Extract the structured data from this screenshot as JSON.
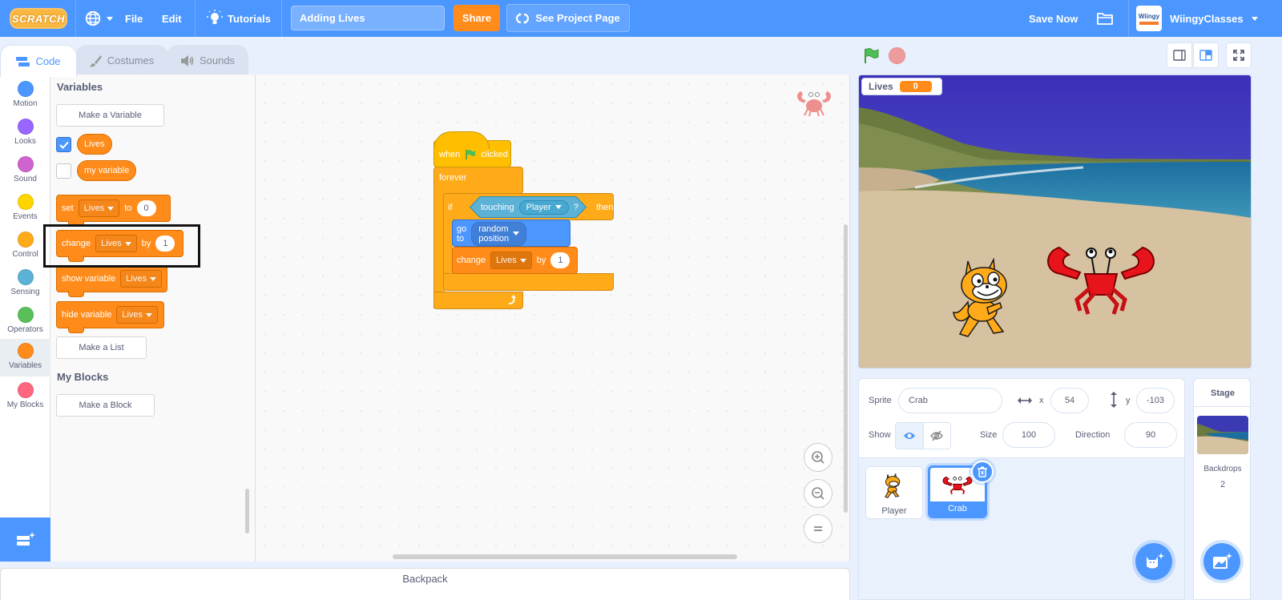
{
  "menubar": {
    "logo": "SCRATCH",
    "file": "File",
    "edit": "Edit",
    "tutorials": "Tutorials",
    "project_title": "Adding Lives",
    "share": "Share",
    "see_project_page": "See Project Page",
    "save_now": "Save Now",
    "username": "WiingyClasses",
    "avatar_text": "Wiingy"
  },
  "tabs": [
    {
      "label": "Code"
    },
    {
      "label": "Costumes"
    },
    {
      "label": "Sounds"
    }
  ],
  "categories": [
    {
      "label": "Motion",
      "color": "#4c97ff"
    },
    {
      "label": "Looks",
      "color": "#9966ff"
    },
    {
      "label": "Sound",
      "color": "#cf63cf"
    },
    {
      "label": "Events",
      "color": "#ffd500"
    },
    {
      "label": "Control",
      "color": "#ffab19"
    },
    {
      "label": "Sensing",
      "color": "#5cb1d6"
    },
    {
      "label": "Operators",
      "color": "#59c059"
    },
    {
      "label": "Variables",
      "color": "#ff8c1a"
    },
    {
      "label": "My Blocks",
      "color": "#ff6680"
    }
  ],
  "palette": {
    "variables_heading": "Variables",
    "make_variable": "Make a Variable",
    "var_lives": "Lives",
    "var_my_variable": "my variable",
    "set_block": {
      "verb": "set",
      "var": "Lives",
      "to": "to",
      "value": "0"
    },
    "change_block": {
      "verb": "change",
      "var": "Lives",
      "by": "by",
      "value": "1"
    },
    "show_block": {
      "verb": "show variable",
      "var": "Lives"
    },
    "hide_block": {
      "verb": "hide variable",
      "var": "Lives"
    },
    "make_list": "Make a List",
    "my_blocks_heading": "My Blocks",
    "make_block": "Make a Block"
  },
  "script": {
    "hat": {
      "when": "when",
      "clicked": "clicked"
    },
    "forever": "forever",
    "if": "if",
    "touching": "touching",
    "touching_target": "Player",
    "question": "?",
    "then": "then",
    "goto": "go to",
    "goto_target": "random position",
    "change": "change",
    "change_var": "Lives",
    "change_by": "by",
    "change_value": "1"
  },
  "backpack": "Backpack",
  "stage": {
    "monitor_label": "Lives",
    "monitor_value": "0"
  },
  "sprite_info": {
    "sprite_label": "Sprite",
    "sprite_name": "Crab",
    "x_label": "x",
    "x_value": "54",
    "y_label": "y",
    "y_value": "-103",
    "show_label": "Show",
    "size_label": "Size",
    "size_value": "100",
    "direction_label": "Direction",
    "direction_value": "90"
  },
  "sprites": [
    {
      "name": "Player",
      "selected": false
    },
    {
      "name": "Crab",
      "selected": true
    }
  ],
  "stage_panel": {
    "title": "Stage",
    "backdrops_label": "Backdrops",
    "backdrops_count": "2"
  },
  "colors": {
    "menubar": "#4c97ff",
    "share": "#ff8c1a",
    "variables": "#ff8c1a",
    "control": "#ffab19",
    "events": "#ffbf00",
    "motion": "#4c97ff",
    "sensing": "#5cb1d6"
  }
}
